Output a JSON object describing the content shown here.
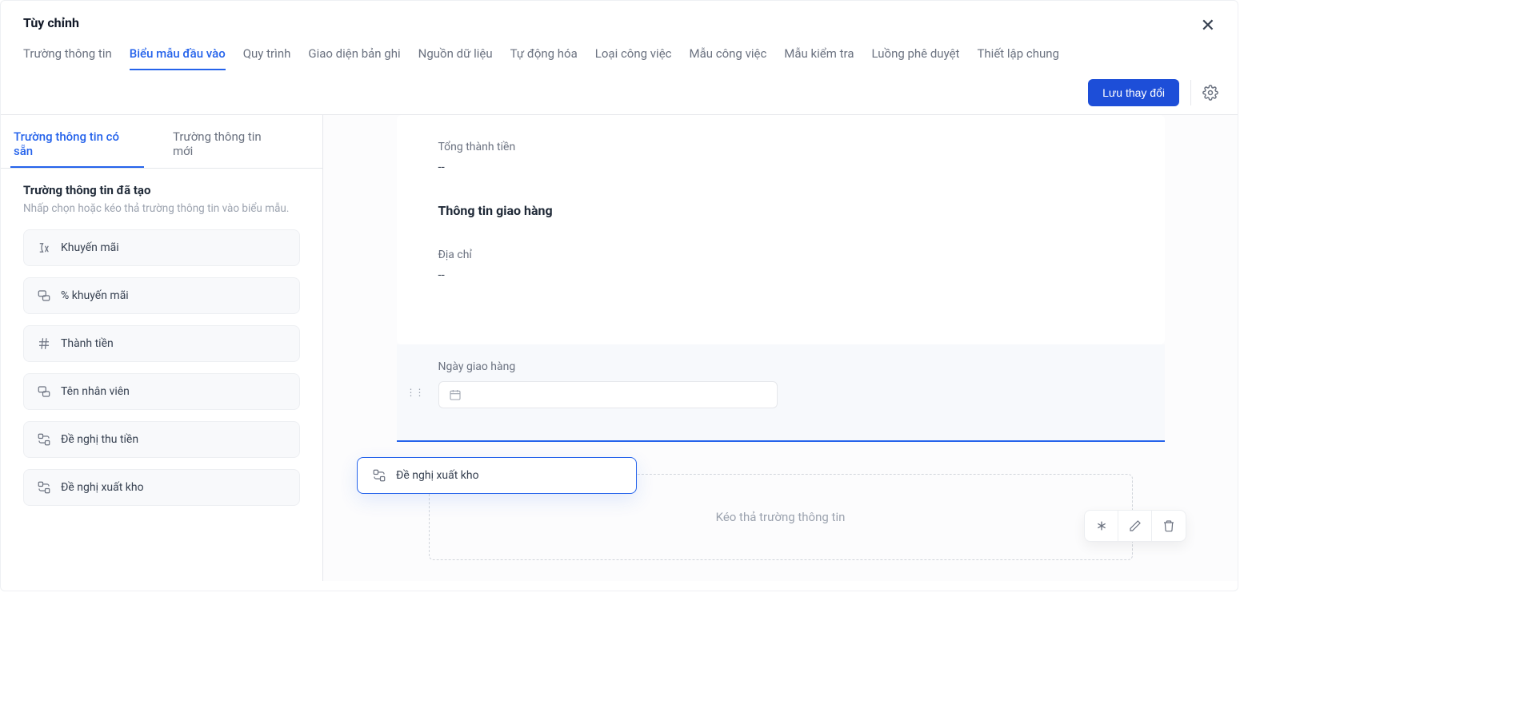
{
  "modal": {
    "title": "Tùy chỉnh"
  },
  "topTabs": [
    {
      "label": "Trường thông tin"
    },
    {
      "label": "Biểu mẫu đầu vào"
    },
    {
      "label": "Quy trình"
    },
    {
      "label": "Giao diện bản ghi"
    },
    {
      "label": "Nguồn dữ liệu"
    },
    {
      "label": "Tự động hóa"
    },
    {
      "label": "Loại công việc"
    },
    {
      "label": "Mẫu công việc"
    },
    {
      "label": "Mẫu kiểm tra"
    },
    {
      "label": "Luồng phê duyệt"
    },
    {
      "label": "Thiết lập chung"
    }
  ],
  "activeTopTab": 1,
  "saveButton": "Lưu thay đổi",
  "leftTabs": [
    {
      "label": "Trường thông tin có sẵn"
    },
    {
      "label": "Trường thông tin mới"
    }
  ],
  "activeLeftTab": 0,
  "leftSection": {
    "title": "Trường thông tin đã tạo",
    "hint": "Nhấp chọn hoặc kéo thả trường thông tin vào biểu mẫu."
  },
  "fields": [
    {
      "icon": "fx",
      "label": "Khuyến mãi"
    },
    {
      "icon": "relation",
      "label": "% khuyến mãi"
    },
    {
      "icon": "hash",
      "label": "Thành tiền"
    },
    {
      "icon": "relation",
      "label": "Tên nhân viên"
    },
    {
      "icon": "relation2",
      "label": "Đề nghị thu tiền"
    },
    {
      "icon": "relation2",
      "label": "Đề nghị xuất kho"
    }
  ],
  "canvas": {
    "totalLabel": "Tổng thành tiền",
    "totalValue": "--",
    "shippingHeading": "Thông tin giao hàng",
    "addressLabel": "Địa chỉ",
    "addressValue": "--",
    "deliveryDateLabel": "Ngày giao hàng",
    "dropHint": "Kéo thả trường thông tin"
  },
  "dragGhost": {
    "icon": "relation2",
    "label": "Đề nghị xuất kho"
  }
}
